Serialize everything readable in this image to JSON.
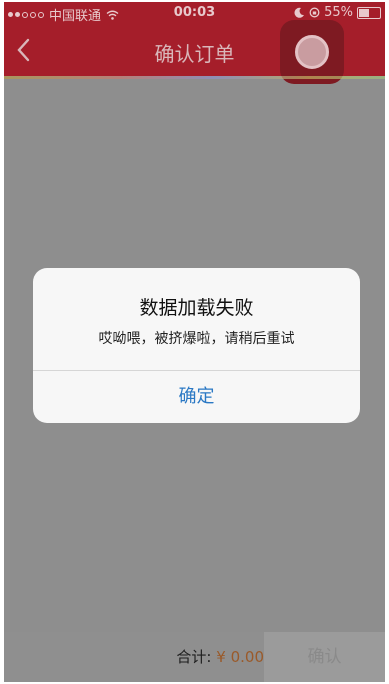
{
  "status": {
    "carrier": "中国联通",
    "time": "00:03",
    "battery": "55%",
    "battery_level": 0.55
  },
  "nav": {
    "title": "确认订单"
  },
  "dialog": {
    "title": "数据加载失败",
    "message": "哎呦喂，被挤爆啦，请稍后重试",
    "ok_label": "确定"
  },
  "footer": {
    "total_label": "合计:",
    "currency": "¥",
    "amount": "0.00",
    "confirm_label": "确认"
  },
  "colors": {
    "nav_bg": "#a51e2a",
    "dialog_button": "#2a78c4",
    "overlay": "#8e8e8e"
  }
}
